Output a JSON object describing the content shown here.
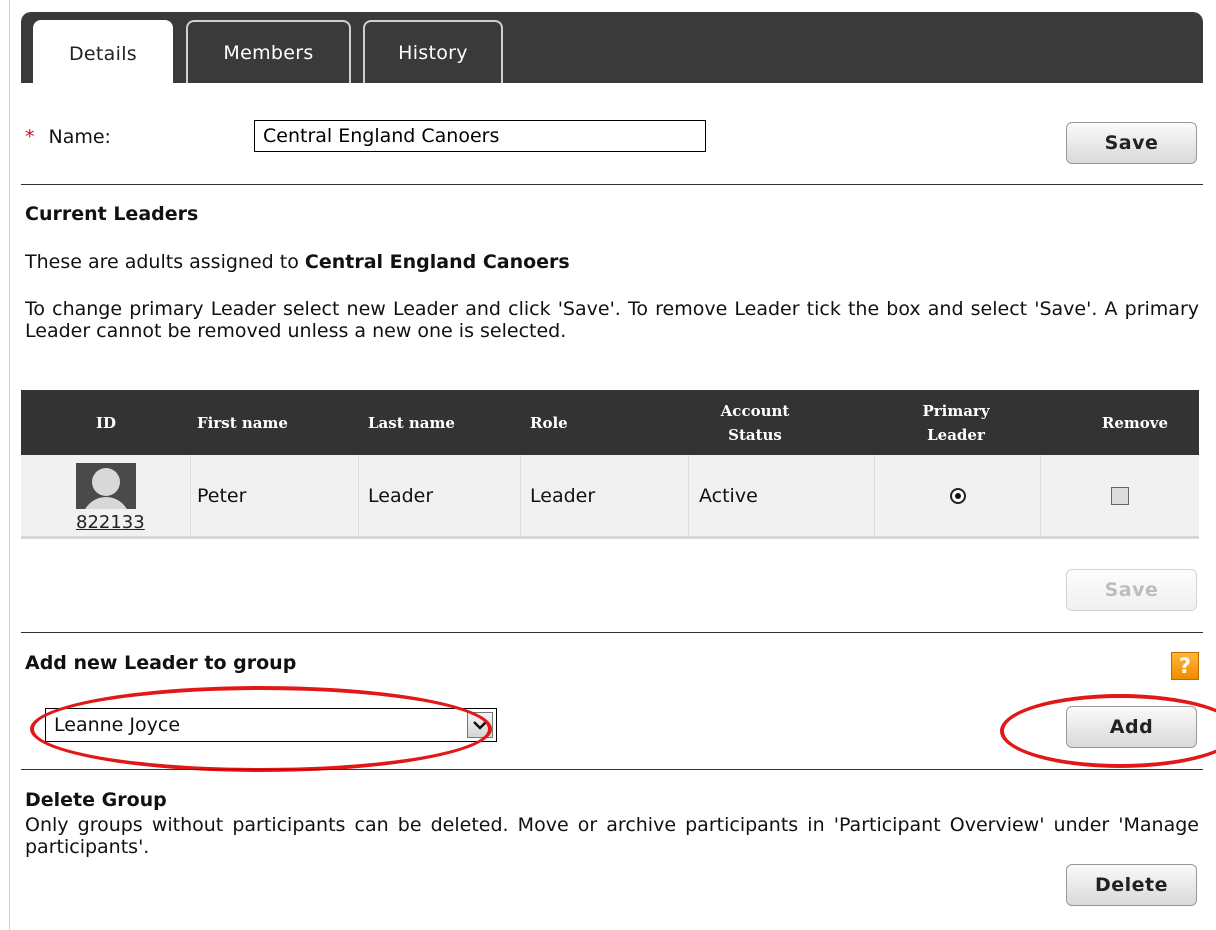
{
  "tabs": [
    {
      "label": "Details",
      "active": true
    },
    {
      "label": "Members",
      "active": false
    },
    {
      "label": "History",
      "active": false
    }
  ],
  "name_field": {
    "required_marker": "*",
    "label": "Name:",
    "value": "Central England Canoers"
  },
  "buttons": {
    "save_top": "Save",
    "save_table": "Save",
    "add": "Add",
    "delete": "Delete"
  },
  "current_leaders": {
    "heading": "Current Leaders",
    "intro_prefix": "These are adults assigned to",
    "group_name": "Central England Canoers",
    "instructions": "To change primary Leader select new Leader and click 'Save'. To remove Leader tick the box and select 'Save'. A primary Leader cannot be removed unless a new one is selected."
  },
  "table": {
    "headers": {
      "id": "ID",
      "first_name": "First name",
      "last_name": "Last name",
      "role": "Role",
      "account_status": "Account Status",
      "primary_leader": "Primary Leader",
      "remove": "Remove"
    },
    "rows": [
      {
        "id": "822133",
        "first_name": "Peter",
        "last_name": "Leader",
        "role": "Leader",
        "account_status": "Active",
        "primary_leader": true,
        "remove": false
      }
    ]
  },
  "add_leader": {
    "heading": "Add new Leader to group",
    "selected": "Leanne Joyce",
    "help_icon": "?"
  },
  "delete_group": {
    "heading": "Delete Group",
    "text": "Only groups without participants can be deleted. Move or archive participants in 'Participant Overview' under 'Manage participants'."
  },
  "colors": {
    "tab_bar": "#3a3a3a",
    "table_header": "#333333",
    "required": "#c8102e",
    "help": "#f39200",
    "annotation": "#e01818"
  }
}
